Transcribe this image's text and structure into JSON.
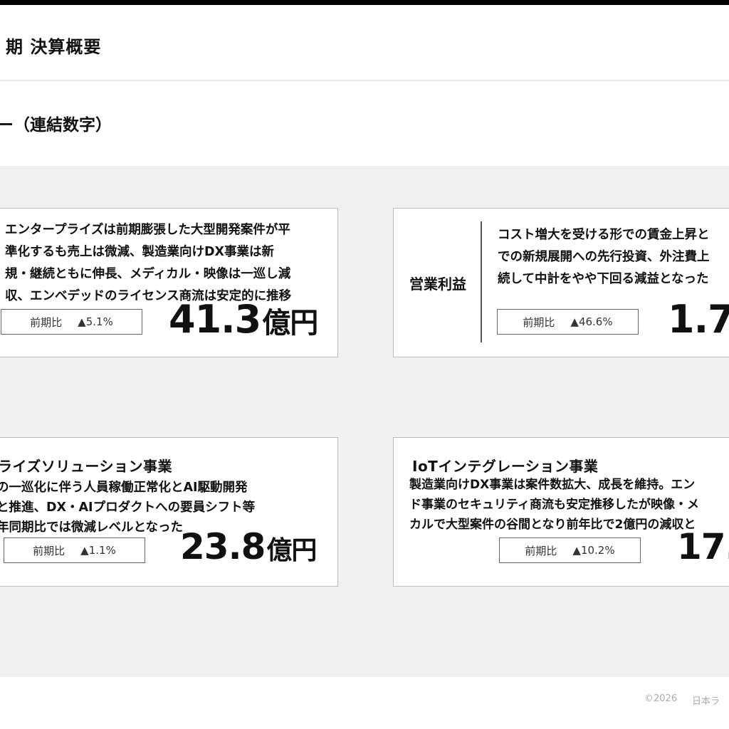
{
  "header": {
    "title": "期 決算概要",
    "section": "ー（連結数字）"
  },
  "cards": {
    "sales": {
      "lines": [
        "エンタープライズは前期膨張した大型開発案件が平",
        "準化するも売上は微減、製造業向けDX事業は新",
        "規・継続ともに伸長、メディカル・映像は一巡し減",
        "収、エンベデッドのライセンス商流は安定的に推移"
      ],
      "yoy_label": "前期比",
      "yoy_value": "▲5.1%",
      "value": "41.3",
      "unit": "億円"
    },
    "op_profit": {
      "label": "営業利益",
      "lines": [
        "コスト増大を受ける形での賃金上昇と",
        "での新規展開への先行投資、外注費上",
        "続して中計をやや下回る減益となった"
      ],
      "yoy_label": "前期比",
      "yoy_value": "▲46.6%",
      "value": "1.7"
    },
    "solution": {
      "heading": "ライズソリューション事業",
      "lines": [
        "の一巡化に伴う人員稼働正常化とAI駆動開発",
        "と推進、DX・AIプロダクトへの要員シフト等",
        "年同期比では微減レベルとなった"
      ],
      "yoy_label": "前期比",
      "yoy_value": "▲1.1%",
      "value": "23.8",
      "unit": "億円"
    },
    "iot": {
      "heading": "IoTインテグレーション事業",
      "lines": [
        "製造業向けDX事業は案件数拡大、成長を維持。エン",
        "ド事業のセキュリティ商流も安定推移したが映像・メ",
        "カルで大型案件の谷間となり前年比で2億円の減収と"
      ],
      "yoy_label": "前期比",
      "yoy_value": "▲10.2%",
      "value": "17."
    }
  },
  "footer": {
    "copyright": "©2026",
    "company": "日本ラ"
  }
}
